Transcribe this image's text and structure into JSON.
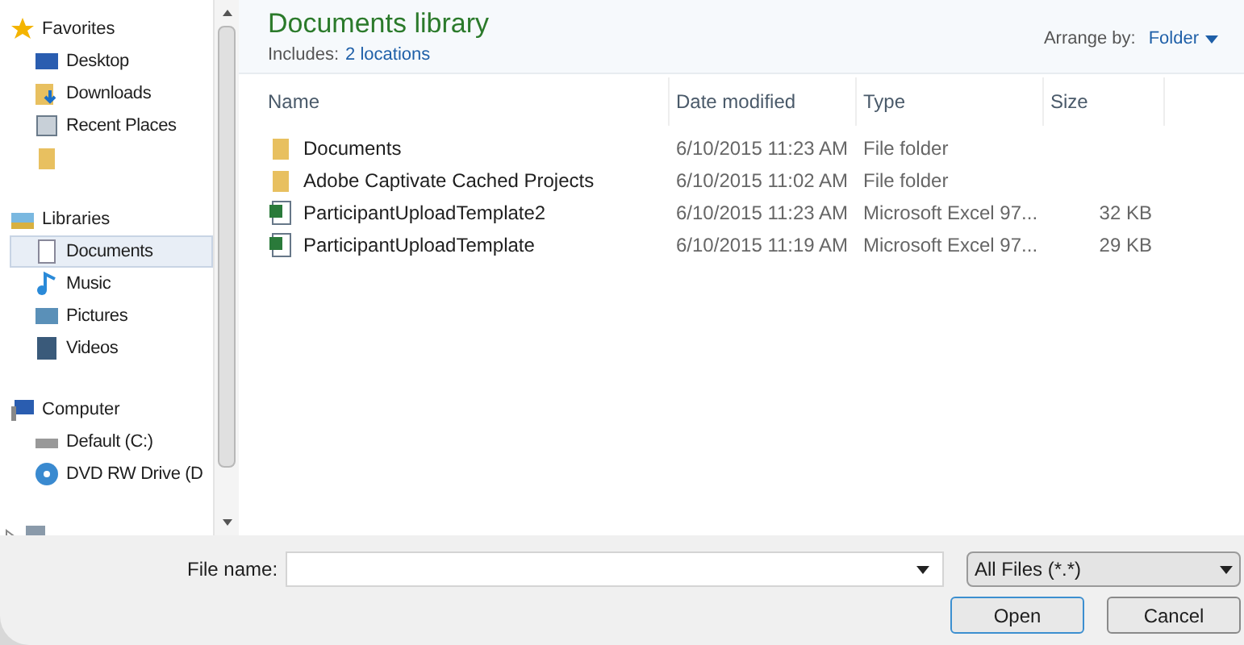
{
  "sidebar": {
    "groups": [
      {
        "label": "Favorites",
        "kind": "favorites",
        "children": [
          {
            "label": "Desktop",
            "kind": "desktop",
            "selected": false
          },
          {
            "label": "Downloads",
            "kind": "downloads",
            "selected": false
          },
          {
            "label": "Recent Places",
            "kind": "recent",
            "selected": false
          },
          {
            "kind": "folder",
            "selected": false
          }
        ]
      },
      {
        "label": "Libraries",
        "kind": "libraries",
        "children": [
          {
            "label": "Documents",
            "kind": "document",
            "selected": true
          },
          {
            "label": "Music",
            "kind": "music",
            "selected": false
          },
          {
            "label": "Pictures",
            "kind": "pictures",
            "selected": false
          },
          {
            "label": "Videos",
            "kind": "videos",
            "selected": false
          }
        ]
      },
      {
        "label": "Computer",
        "kind": "computer",
        "children": [
          {
            "label": "Default (C:)",
            "kind": "drive",
            "selected": false
          },
          {
            "label": "DVD RW Drive (D",
            "kind": "dvd",
            "selected": false
          }
        ]
      },
      {
        "kind": "network",
        "expanded": false
      }
    ]
  },
  "library": {
    "title": "Documents library",
    "includes_label": "Includes:",
    "includes_link": "2 locations",
    "arrange_label": "Arrange by:",
    "arrange_value": "Folder"
  },
  "table": {
    "columns": [
      "Name",
      "Date modified",
      "Type",
      "Size"
    ],
    "rows": [
      {
        "kind": "folder",
        "name": "Documents",
        "date": "6/10/2015 11:23 AM",
        "type": "File folder"
      },
      {
        "kind": "folder",
        "name": "Adobe Captivate Cached Projects",
        "date": "6/10/2015 11:02 AM",
        "type": "File folder"
      },
      {
        "kind": "excel",
        "name": "ParticipantUploadTemplate2",
        "date": "6/10/2015 11:23 AM",
        "type": "Microsoft Excel 97...",
        "size": "32 KB"
      },
      {
        "kind": "excel",
        "name": "ParticipantUploadTemplate",
        "date": "6/10/2015 11:19 AM",
        "type": "Microsoft Excel 97...",
        "size": "29 KB"
      }
    ]
  },
  "footer": {
    "file_name_label": "File name:",
    "filter": "All Files (*.*)",
    "buttons": [
      "Open",
      "Cancel"
    ]
  }
}
